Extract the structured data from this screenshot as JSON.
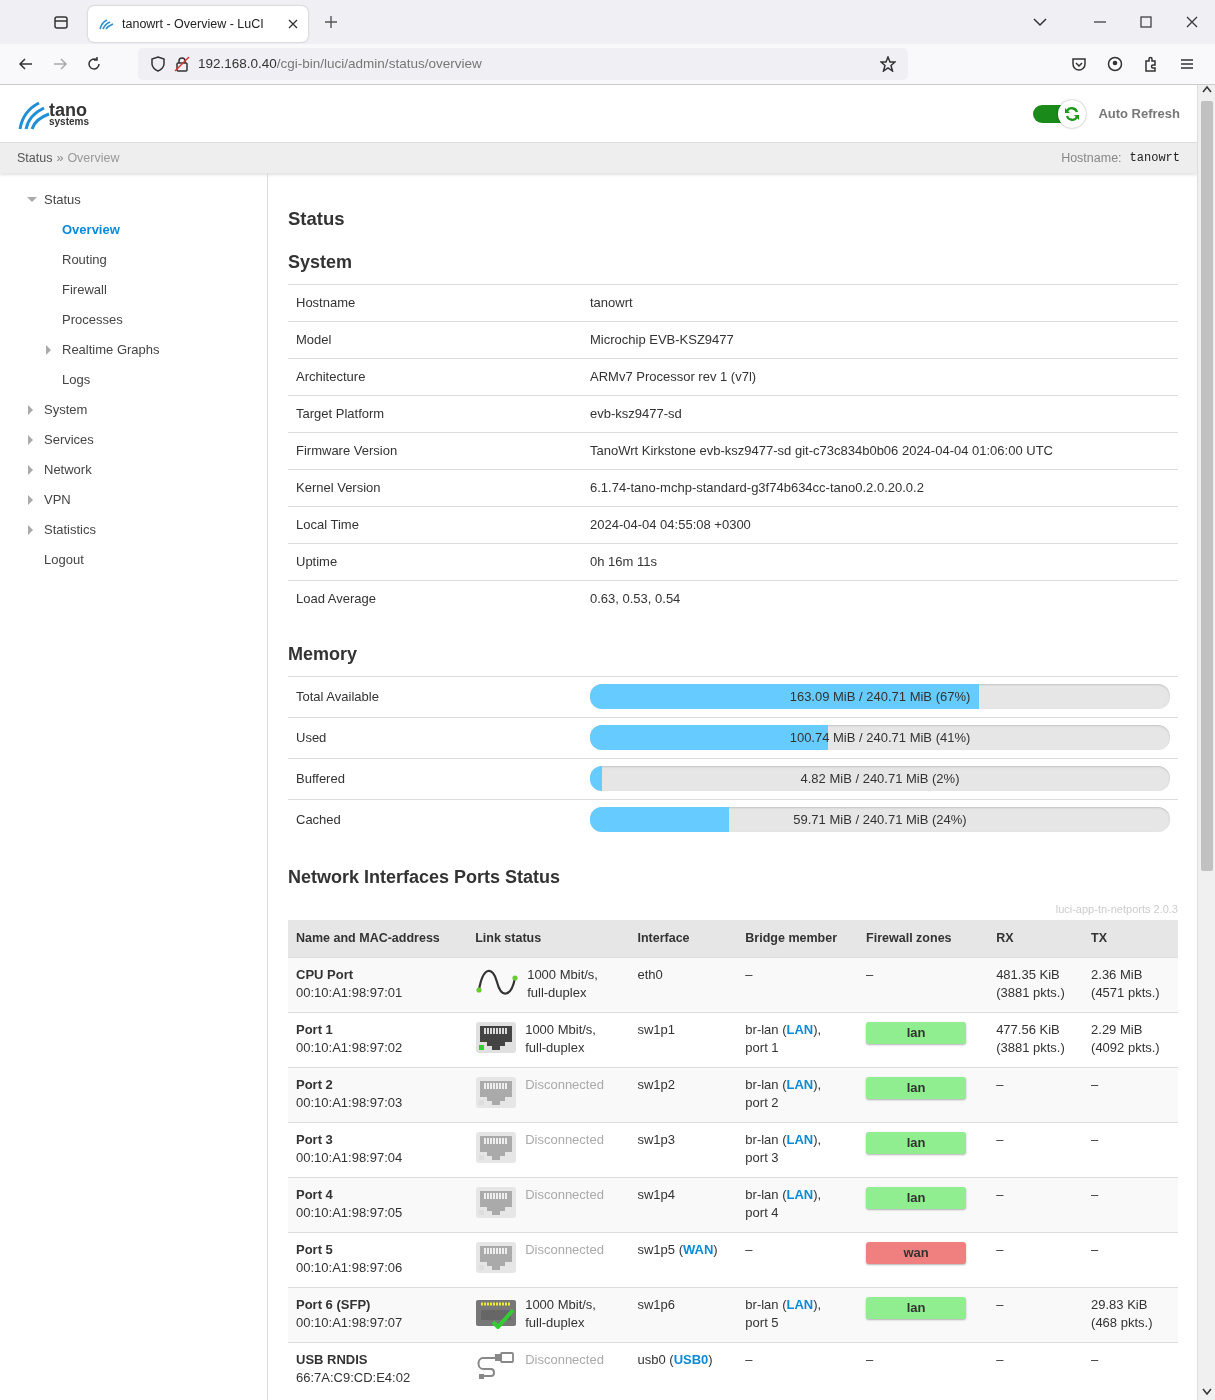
{
  "browser": {
    "tab_title": "tanowrt - Overview - LuCI",
    "url_host": "192.168.0.40",
    "url_path": "/cgi-bin/luci/admin/status/overview"
  },
  "header": {
    "logo_top": "tano",
    "logo_bottom": "systems",
    "auto_refresh": {
      "label": "Auto Refresh",
      "on": true
    }
  },
  "breadcrumb": {
    "items": [
      "Status",
      "Overview"
    ],
    "separator": "»",
    "hostname_label": "Hostname:",
    "hostname": "tanowrt"
  },
  "sidebar": {
    "items": [
      {
        "label": "Status",
        "expanded": true,
        "children": [
          {
            "label": "Overview",
            "selected": true
          },
          {
            "label": "Routing",
            "selected": false
          },
          {
            "label": "Firewall",
            "selected": false
          },
          {
            "label": "Processes",
            "selected": false
          },
          {
            "label": "Realtime Graphs",
            "selected": false,
            "expanded": false
          },
          {
            "label": "Logs",
            "selected": false
          }
        ]
      },
      {
        "label": "System",
        "expanded": false
      },
      {
        "label": "Services",
        "expanded": false
      },
      {
        "label": "Network",
        "expanded": false
      },
      {
        "label": "VPN",
        "expanded": false
      },
      {
        "label": "Statistics",
        "expanded": false
      },
      {
        "label": "Logout"
      }
    ]
  },
  "page_title": "Status",
  "system": {
    "title": "System",
    "rows": [
      {
        "label": "Hostname",
        "value": "tanowrt"
      },
      {
        "label": "Model",
        "value": "Microchip EVB-KSZ9477"
      },
      {
        "label": "Architecture",
        "value": "ARMv7 Processor rev 1 (v7l)"
      },
      {
        "label": "Target Platform",
        "value": "evb-ksz9477-sd"
      },
      {
        "label": "Firmware Version",
        "value": "TanoWrt Kirkstone evb-ksz9477-sd git-c73c834b0b06 2024-04-04 01:06:00 UTC"
      },
      {
        "label": "Kernel Version",
        "value": "6.1.74-tano-mchp-standard-g3f74b634cc-tano0.2.0.20.0.2"
      },
      {
        "label": "Local Time",
        "value": "2024-04-04 04:55:08 +0300"
      },
      {
        "label": "Uptime",
        "value": "0h 16m 11s"
      },
      {
        "label": "Load Average",
        "value": "0.63, 0.53, 0.54"
      }
    ]
  },
  "memory": {
    "title": "Memory",
    "rows": [
      {
        "label": "Total Available",
        "level": 0.67,
        "reading": "163.09 MiB / 240.71 MiB (67%)"
      },
      {
        "label": "Used",
        "level": 0.41,
        "reading": "100.74 MiB / 240.71 MiB (41%)"
      },
      {
        "label": "Buffered",
        "level": 0.02,
        "reading": "4.82 MiB / 240.71 MiB (2%)"
      },
      {
        "label": "Cached",
        "level": 0.24,
        "reading": "59.71 MiB / 240.71 MiB (24%)"
      }
    ]
  },
  "ports": {
    "title": "Network Interfaces Ports Status",
    "version": "luci-app-tn-netports 2.0.3",
    "columns": [
      "Name and MAC-address",
      "Link status",
      "Interface",
      "Bridge member",
      "Firewall zones",
      "RX",
      "TX"
    ],
    "rows": [
      {
        "name": "CPU Port",
        "mac": "00:10:A1:98:97:01",
        "link": {
          "kind": "cpu",
          "connected": true,
          "lines": [
            "1000 Mbit/s,",
            "full-duplex"
          ]
        },
        "interface": {
          "name": "eth0"
        },
        "bridge": {
          "text": "–"
        },
        "zone": {
          "text": "–"
        },
        "rx": [
          "481.35 KiB",
          "(3881 pkts.)"
        ],
        "tx": [
          "2.36 MiB",
          "(4571 pkts.)"
        ]
      },
      {
        "name": "Port 1",
        "mac": "00:10:A1:98:97:02",
        "link": {
          "kind": "rj45",
          "connected": true,
          "lines": [
            "1000 Mbit/s,",
            "full-duplex"
          ]
        },
        "interface": {
          "name": "sw1p1"
        },
        "bridge": {
          "before": "br-lan (",
          "link": "LAN",
          "after": "),",
          "line2": "port 1"
        },
        "zone": {
          "label": "lan",
          "color": "#90ee90"
        },
        "rx": [
          "477.56 KiB",
          "(3881 pkts.)"
        ],
        "tx": [
          "2.29 MiB",
          "(4092 pkts.)"
        ]
      },
      {
        "name": "Port 2",
        "mac": "00:10:A1:98:97:03",
        "link": {
          "kind": "rj45",
          "connected": false,
          "lines": [
            "Disconnected"
          ]
        },
        "interface": {
          "name": "sw1p2"
        },
        "bridge": {
          "before": "br-lan (",
          "link": "LAN",
          "after": "),",
          "line2": "port 2"
        },
        "zone": {
          "label": "lan",
          "color": "#90ee90"
        },
        "rx": [
          "–"
        ],
        "tx": [
          "–"
        ]
      },
      {
        "name": "Port 3",
        "mac": "00:10:A1:98:97:04",
        "link": {
          "kind": "rj45",
          "connected": false,
          "lines": [
            "Disconnected"
          ]
        },
        "interface": {
          "name": "sw1p3"
        },
        "bridge": {
          "before": "br-lan (",
          "link": "LAN",
          "after": "),",
          "line2": "port 3"
        },
        "zone": {
          "label": "lan",
          "color": "#90ee90"
        },
        "rx": [
          "–"
        ],
        "tx": [
          "–"
        ]
      },
      {
        "name": "Port 4",
        "mac": "00:10:A1:98:97:05",
        "link": {
          "kind": "rj45",
          "connected": false,
          "lines": [
            "Disconnected"
          ]
        },
        "interface": {
          "name": "sw1p4"
        },
        "bridge": {
          "before": "br-lan (",
          "link": "LAN",
          "after": "),",
          "line2": "port 4"
        },
        "zone": {
          "label": "lan",
          "color": "#90ee90"
        },
        "rx": [
          "–"
        ],
        "tx": [
          "–"
        ]
      },
      {
        "name": "Port 5",
        "mac": "00:10:A1:98:97:06",
        "link": {
          "kind": "rj45",
          "connected": false,
          "lines": [
            "Disconnected"
          ]
        },
        "interface": {
          "name": "sw1p5",
          "before": " (",
          "link": "WAN",
          "after": ")"
        },
        "bridge": {
          "text": "–"
        },
        "zone": {
          "label": "wan",
          "color": "#f08080"
        },
        "rx": [
          "–"
        ],
        "tx": [
          "–"
        ]
      },
      {
        "name": "Port 6 (SFP)",
        "mac": "00:10:A1:98:97:07",
        "link": {
          "kind": "sfp",
          "connected": true,
          "lines": [
            "1000 Mbit/s,",
            "full-duplex"
          ]
        },
        "interface": {
          "name": "sw1p6"
        },
        "bridge": {
          "before": "br-lan (",
          "link": "LAN",
          "after": "),",
          "line2": "port 5"
        },
        "zone": {
          "label": "lan",
          "color": "#90ee90"
        },
        "rx": [
          "–"
        ],
        "tx": [
          "29.83 KiB",
          "(468 pkts.)"
        ]
      },
      {
        "name": "USB RNDIS",
        "mac": "66:7A:C9:CD:E4:02",
        "link": {
          "kind": "usb",
          "connected": false,
          "lines": [
            "Disconnected"
          ]
        },
        "interface": {
          "name": "usb0",
          "before": " (",
          "link": "USB0",
          "after": ")"
        },
        "bridge": {
          "text": "–"
        },
        "zone": {
          "text": "–"
        },
        "rx": [
          "–"
        ],
        "tx": [
          "–"
        ]
      }
    ]
  }
}
